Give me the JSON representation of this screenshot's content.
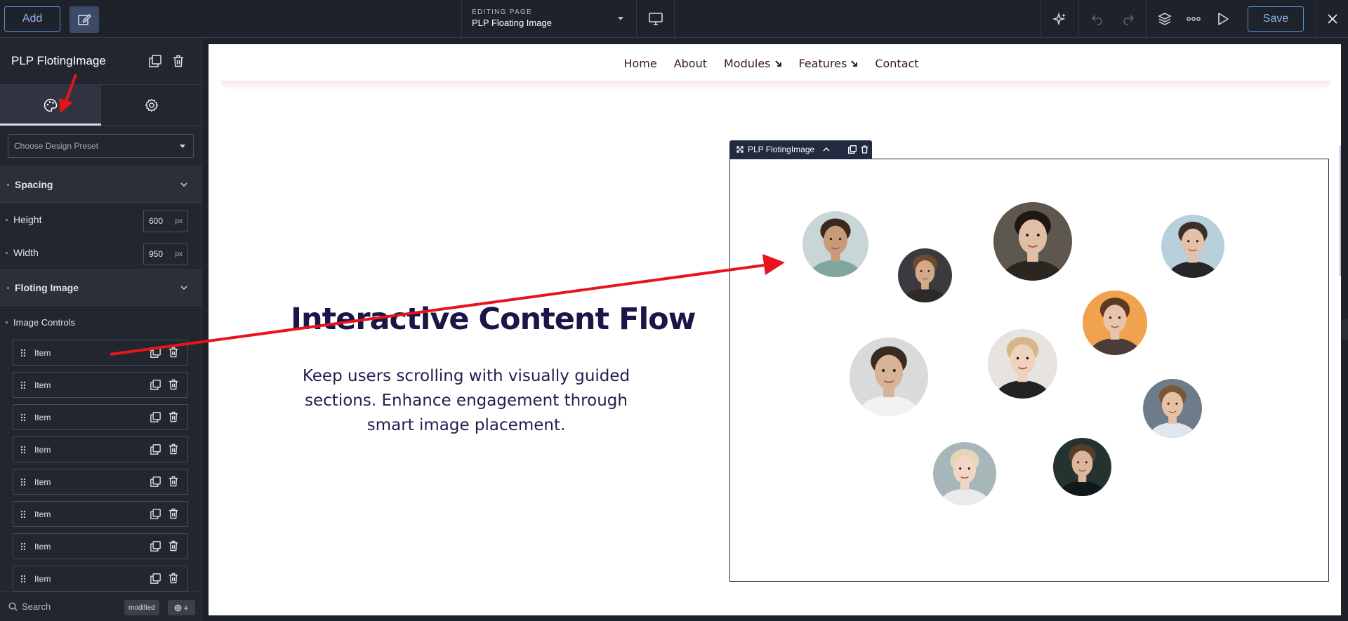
{
  "topbar": {
    "add_label": "Add",
    "editing_label": "EDITING PAGE",
    "editing_value": "PLP Floating Image",
    "save_label": "Save"
  },
  "panel": {
    "title": "PLP FlotingImage",
    "preset_placeholder": "Choose Design Preset",
    "sections": {
      "spacing": "Spacing",
      "floting": "Floting Image"
    },
    "fields": {
      "height_label": "Height",
      "height_value": "600",
      "width_label": "Width",
      "width_value": "950",
      "unit": "px"
    },
    "image_controls": "Image Controls",
    "items": [
      "Item",
      "Item",
      "Item",
      "Item",
      "Item",
      "Item",
      "Item",
      "Item"
    ],
    "footer": {
      "search": "Search",
      "modified": "modified",
      "add_symbol": "+"
    }
  },
  "page": {
    "nav": [
      "Home",
      "About",
      "Modules",
      "Features",
      "Contact"
    ],
    "hero_title": "Interactive Content Flow",
    "hero_text": "Keep users scrolling with visually guided sections. Enhance engagement through smart image placement.",
    "selected_label": "PLP FlotingImage"
  },
  "colors": {
    "accent": "#5a8fd6",
    "arrow": "#e8141c",
    "heading": "#1b1548",
    "nav_text": "#3b1f16"
  }
}
